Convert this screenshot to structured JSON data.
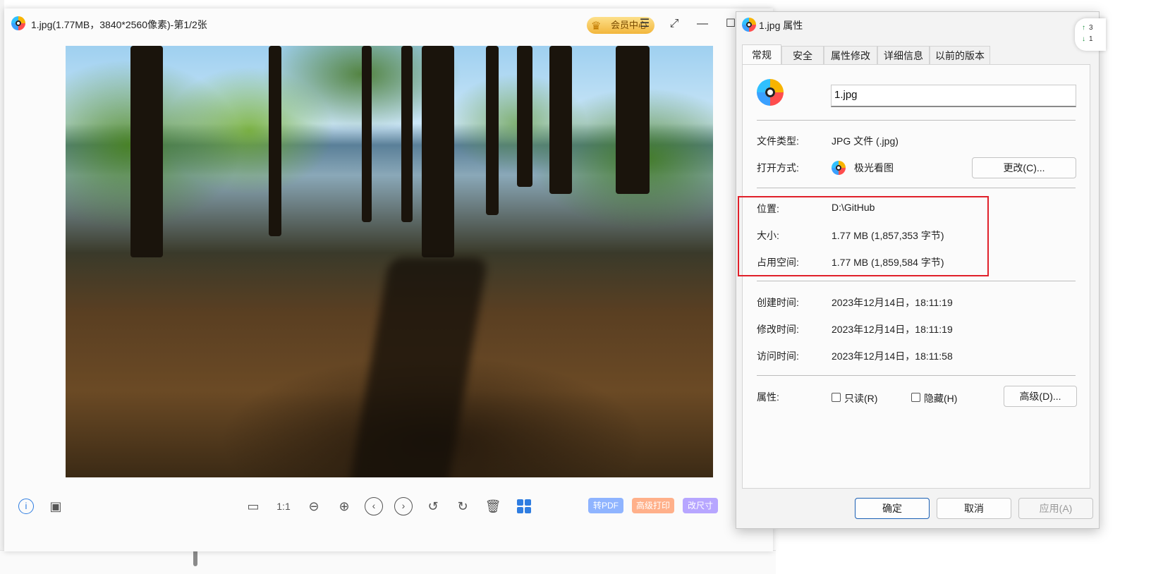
{
  "viewer": {
    "title": "1.jpg(1.77MB，3840*2560像素)-第1/2张",
    "vip_label": "会员中心",
    "toolbar": {
      "pills": [
        {
          "label": "转PDF",
          "color": "#8fb4ff"
        },
        {
          "label": "高级打印",
          "color": "#ffb08a"
        },
        {
          "label": "改尺寸",
          "color": "#b7a6ff"
        }
      ]
    }
  },
  "dialog": {
    "title": "1.jpg 属性",
    "tabs": [
      "常规",
      "安全",
      "属性修改",
      "详细信息",
      "以前的版本"
    ],
    "filename": "1.jpg",
    "file_type_label": "文件类型:",
    "file_type_value": "JPG 文件 (.jpg)",
    "open_with_label": "打开方式:",
    "open_with_value": "极光看图",
    "change_button": "更改(C)...",
    "location_label": "位置:",
    "location_value": "D:\\GitHub",
    "size_label": "大小:",
    "size_value": "1.77 MB (1,857,353 字节)",
    "disk_label": "占用空间:",
    "disk_value": "1.77 MB (1,859,584 字节)",
    "created_label": "创建时间:",
    "created_value": "2023年12月14日，18:11:19",
    "modified_label": "修改时间:",
    "modified_value": "2023年12月14日，18:11:19",
    "accessed_label": "访问时间:",
    "accessed_value": "2023年12月14日，18:11:58",
    "attributes_label": "属性:",
    "readonly_label": "只读(R)",
    "hidden_label": "隐藏(H)",
    "advanced_button": "高级(D)...",
    "ok_button": "确定",
    "cancel_button": "取消",
    "apply_button": "应用(A)"
  },
  "widget": {
    "up": "3",
    "down": "1"
  }
}
